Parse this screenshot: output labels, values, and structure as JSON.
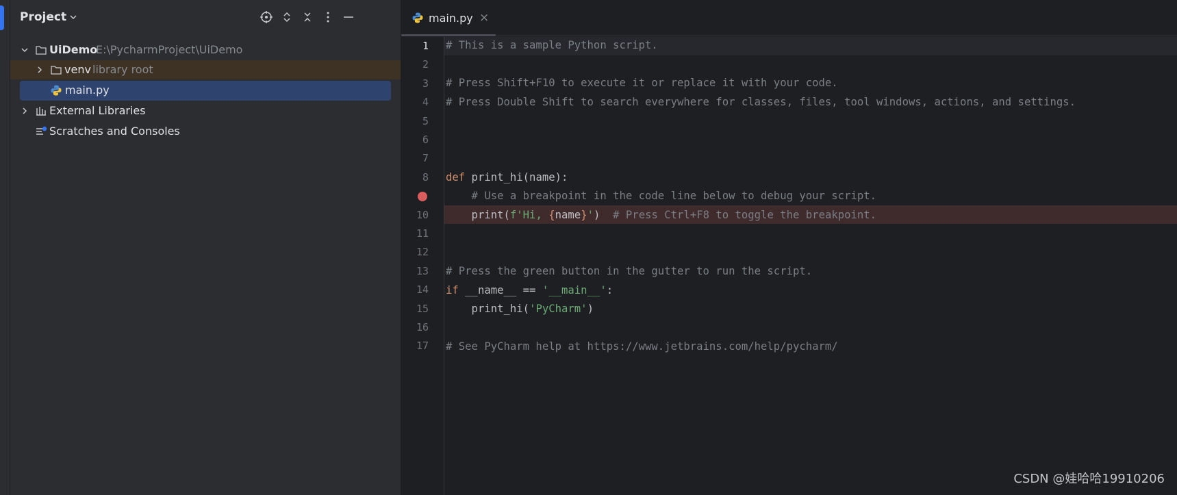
{
  "project_panel": {
    "title": "Project",
    "tree": {
      "root": {
        "name": "UiDemo",
        "path": "E:\\PycharmProject\\UiDemo"
      },
      "venv": {
        "name": "venv",
        "hint": "library root"
      },
      "main": {
        "name": "main.py"
      },
      "external": {
        "name": "External Libraries"
      },
      "scratches": {
        "name": "Scratches and Consoles"
      }
    }
  },
  "editor": {
    "tab": {
      "label": "main.py",
      "close": "×"
    },
    "lines": [
      {
        "num": "1",
        "current": true
      },
      {
        "num": "2"
      },
      {
        "num": "3"
      },
      {
        "num": "4"
      },
      {
        "num": "5"
      },
      {
        "num": "6"
      },
      {
        "num": "7"
      },
      {
        "num": "8"
      },
      {
        "num": "",
        "breakpoint": true
      },
      {
        "num": "10"
      },
      {
        "num": "11"
      },
      {
        "num": "12"
      },
      {
        "num": "13"
      },
      {
        "num": "14"
      },
      {
        "num": "15"
      },
      {
        "num": "16"
      },
      {
        "num": "17"
      }
    ],
    "code": {
      "l1": "# This is a sample Python script.",
      "l3": "# Press Shift+F10 to execute it or replace it with your code.",
      "l4": "# Press Double Shift to search everywhere for classes, files, tool windows, actions, and settings.",
      "l7_kw": "def",
      "l7_rest": " print_hi(name):",
      "l8": "    # Use a breakpoint in the code line below to debug your script.",
      "l9_a": "    print(",
      "l9_str1": "f'Hi, ",
      "l9_brace_open": "{",
      "l9_name": "name",
      "l9_brace_close": "}",
      "l9_str2": "'",
      "l9_b": ")  ",
      "l9_comment": "# Press Ctrl+F8 to toggle the breakpoint.",
      "l12": "# Press the green button in the gutter to run the script.",
      "l13_kw": "if",
      "l13_mid": " __name__ == ",
      "l13_str": "'__main__'",
      "l13_end": ":",
      "l14_a": "    print_hi(",
      "l14_str": "'PyCharm'",
      "l14_b": ")",
      "l16": "# See PyCharm help at https://www.jetbrains.com/help/pycharm/"
    }
  },
  "watermark": "CSDN @娃哈哈19910206",
  "colors": {
    "accent": "#3574f0",
    "breakpoint": "#db5c5c",
    "selection": "#2e436e"
  }
}
